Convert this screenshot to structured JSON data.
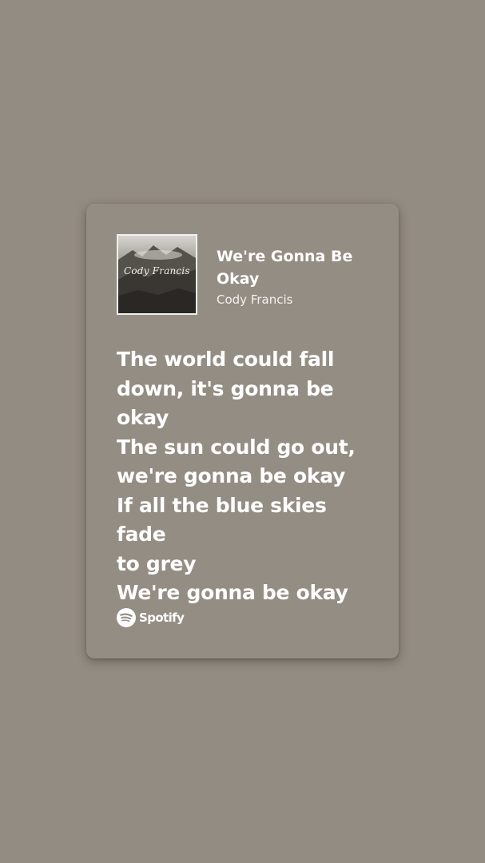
{
  "colors": {
    "background": "#938c82",
    "card": "#948d83",
    "text": "#ffffff"
  },
  "track": {
    "title": "We're Gonna Be Okay",
    "artist": "Cody Francis",
    "cover_text": "Cody Francis"
  },
  "lyrics": [
    "The world could fall",
    "down, it's gonna be",
    "okay",
    "The sun could go out,",
    "we're gonna be okay",
    "If all the blue skies fade",
    "to grey",
    "We're gonna be okay"
  ],
  "footer": {
    "brand": "Spotify",
    "icon": "spotify-logo-icon"
  }
}
